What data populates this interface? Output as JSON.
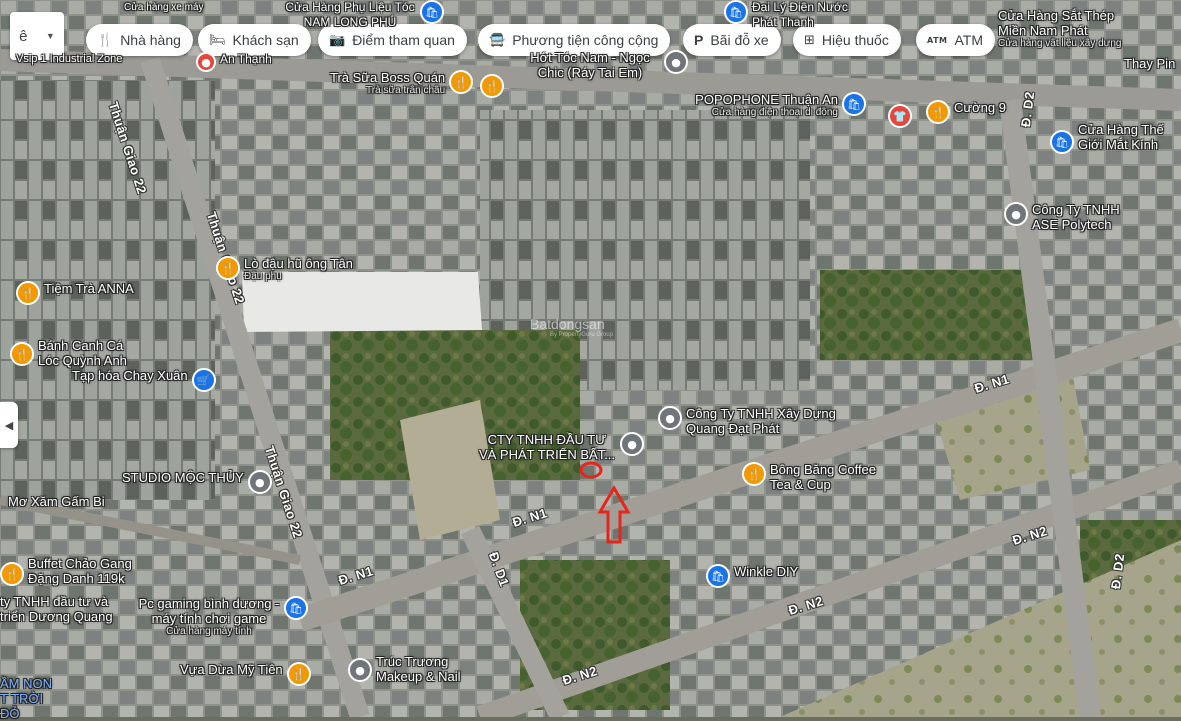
{
  "lang_button": {
    "label": "ê"
  },
  "filter_chips": [
    {
      "label": "Nhà hàng",
      "icon": "fork-knife-icon"
    },
    {
      "label": "Khách sạn",
      "icon": "bed-icon"
    },
    {
      "label": "Điểm tham quan",
      "icon": "camera-icon"
    },
    {
      "label": "Phương tiện công cộng",
      "icon": "bus-icon"
    },
    {
      "label": "Bãi đỗ xe",
      "icon": "parking-icon"
    },
    {
      "label": "Hiệu thuốc",
      "icon": "pharmacy-icon"
    },
    {
      "label": "ATM",
      "icon": "atm-icon"
    }
  ],
  "pois": {
    "tra_sua": {
      "name": "Trà Sữa Boss Quán",
      "sub": "Trà sữa trân châu"
    },
    "hot_toc": {
      "name": "Hớt Tóc Nam - Ngọc Chic (Ráy Tai Em)"
    },
    "popophone": {
      "name": "POPOPHONE Thuận An",
      "sub": "Cửa hàng điện thoại di động"
    },
    "cuong9": {
      "name": "Cường 9"
    },
    "the_gioi_mat_kinh": {
      "name": "Cửa Hàng Thế Giới Mắt Kính"
    },
    "ase": {
      "name": "Công Ty TNHH ASE Polytech"
    },
    "sat_thep": {
      "name": "Cửa Hàng Sắt Thép Miền Nam Phát",
      "sub": "Cửa hàng vật liệu xây dựng"
    },
    "thay_pin": {
      "name": "Thay Pin"
    },
    "lo_dau_hu": {
      "name": "Lò đậu hũ ông Tân",
      "sub": "Đậu phụ"
    },
    "tiem_tra": {
      "name": "Tiệm Trà ANNA"
    },
    "banh_canh": {
      "name": "Bánh Canh Cá Lóc Quỳnh Anh"
    },
    "tap_hoa": {
      "name": "Tạp hóa Chay Xuân"
    },
    "xay_dung": {
      "name": "Công Ty TNHH Xây Dựng Quang Đạt Phát"
    },
    "cty_dau_tu": {
      "name": "CTY TNHH ĐẦU TƯ VÀ PHÁT TRIỂN BẤT..."
    },
    "bong_bang": {
      "name": "Bông Băng Coffee Tea & Cup"
    },
    "studio": {
      "name": "STUDIO MỘC THỦY"
    },
    "mo_xam": {
      "name": "Mơ Xăm Gấm Bi"
    },
    "buffet": {
      "name": "Buffet Chảo Gang Đặng Danh 119k"
    },
    "duong_quang": {
      "name": "ty TNHH đầu tư và triển Dương Quang"
    },
    "pc_gaming": {
      "name": "Pc gaming bình dương - máy tính chơi game",
      "sub": "Cửa hàng máy tính"
    },
    "winkle": {
      "name": "Winkle DIY"
    },
    "truc_truong": {
      "name": "Trúc Trương Makeup & Nail"
    },
    "vua_dua": {
      "name": "Vựa Dừa Mỹ Tiên"
    },
    "mam_non": {
      "name": "ẦM NON T TRỜI ĐỎ"
    },
    "top_center": {
      "name": "Cửa Hàng Phụ Liệu Tóc NAM LONG PHÚ"
    },
    "top_right": {
      "name": "Đại Lý Điện Nước Phát Thanh"
    },
    "top_left": {
      "name": "Cửa hàng xe máy"
    },
    "industrial": {
      "name": "Vsip 1 Industrial Zone"
    },
    "an_thanh": {
      "name": "An Thạnh"
    }
  },
  "roads": {
    "thuan_giao_22_a": "Thuận Giao 22",
    "thuan_giao_22_b": "Thuận Giao 22",
    "thuan_giao_22_c": "Thuận Giao 22",
    "d_d2_a": "Đ. D2",
    "d_d2_b": "Đ. D2",
    "d_n1_a": "Đ. N1",
    "d_n1_b": "Đ. N1",
    "d_n1_c": "Đ. N1",
    "d_d1": "Đ. D1",
    "d_n2_a": "Đ. N2",
    "d_n2_b": "Đ. N2",
    "d_n2_c": "Đ. N2"
  },
  "watermark": {
    "text": "Batdongsan",
    "sub": "By PropertyGuru Group"
  },
  "colors": {
    "marker": "#e8251a",
    "pin_food": "#f29900",
    "pin_shop": "#1a73e8",
    "pin_place": "#70757a",
    "pin_red": "#e8453c"
  }
}
